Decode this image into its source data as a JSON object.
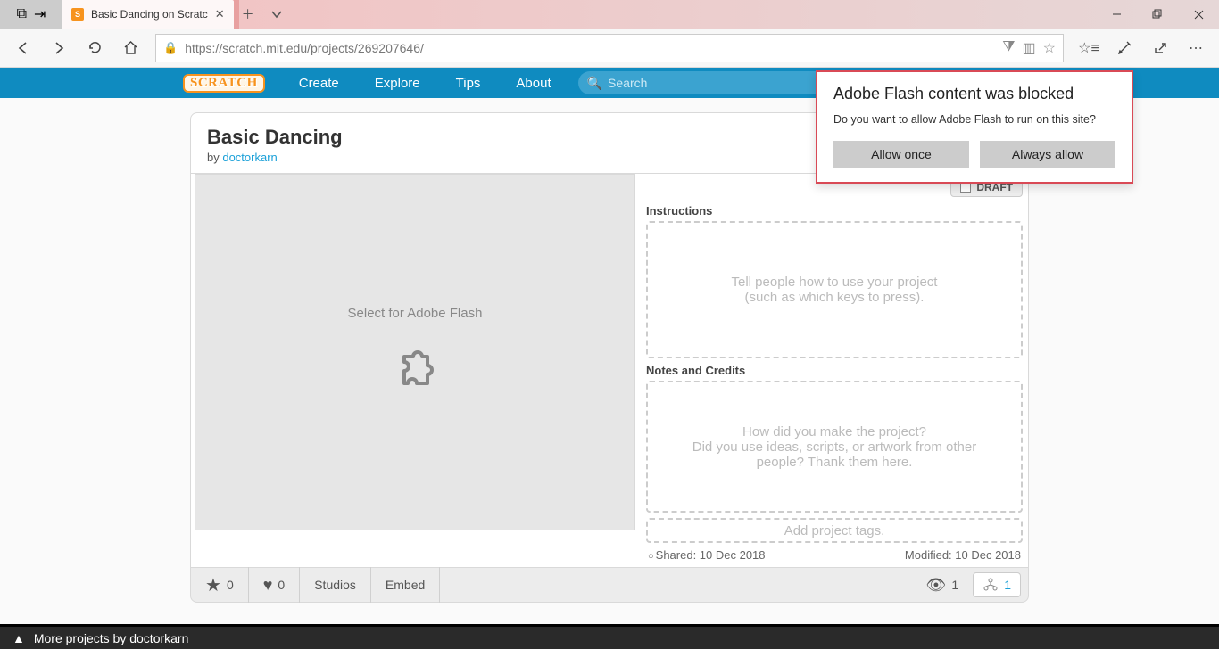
{
  "browser": {
    "tab_title": "Basic Dancing on Scratc",
    "url": "https://scratch.mit.edu/projects/269207646/"
  },
  "flash_popup": {
    "title": "Adobe Flash content was blocked",
    "body": "Do you want to allow Adobe Flash to run on this site?",
    "allow_once": "Allow once",
    "always_allow": "Always allow"
  },
  "nav": {
    "logo": "SCRATCH",
    "create": "Create",
    "explore": "Explore",
    "tips": "Tips",
    "about": "About",
    "search_placeholder": "Search"
  },
  "project": {
    "title": "Basic Dancing",
    "by_prefix": "by ",
    "author": "doctorkarn",
    "draft_label": "DRAFT",
    "stage_text": "Select for Adobe Flash",
    "instructions_label": "Instructions",
    "instructions_placeholder": "Tell people how to use your project\n(such as which keys to press).",
    "notes_label": "Notes and Credits",
    "notes_placeholder": "How did you make the project?\nDid you use ideas, scripts, or artwork from other people? Thank them here.",
    "tags_placeholder": "Add project tags.",
    "shared_label": "Shared: 10 Dec 2018",
    "modified_label": "Modified: 10 Dec 2018",
    "fav_count": "0",
    "love_count": "0",
    "studios_label": "Studios",
    "embed_label": "Embed",
    "views": "1",
    "remix_count": "1"
  },
  "footer": {
    "more_projects": "More projects by doctorkarn"
  }
}
